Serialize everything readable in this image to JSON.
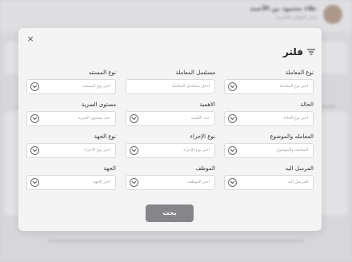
{
  "background": {
    "user_name": "علاء محمود بن الأحمد",
    "user_role": "مدير الموارد البشرية"
  },
  "modal": {
    "title": "فلتر",
    "close_glyph": "×",
    "search_label": "بحث",
    "fields": [
      {
        "label": "نوع المعاملة",
        "placeholder": "اختر نوع المعاملة"
      },
      {
        "label": "مسلسل المعاملة",
        "placeholder": "ادخل مسلسل المعاملة"
      },
      {
        "label": "نوع المستند",
        "placeholder": "اختر نوع المستند"
      },
      {
        "label": "الحالة",
        "placeholder": "اختر نوع الحالة"
      },
      {
        "label": "الاهمية",
        "placeholder": "حدد الأهمية"
      },
      {
        "label": "مستوى السرية",
        "placeholder": "حدد مستوى السرية"
      },
      {
        "label": "المعامله والموضوع",
        "placeholder": "المعاملة والموضوع"
      },
      {
        "label": "نوع الإجراء",
        "placeholder": "اختر نوع الإجراء"
      },
      {
        "label": "نوع الجهة",
        "placeholder": "اختر نوع الاجراء"
      },
      {
        "label": "المرسل اليه",
        "placeholder": "المرسل اليه"
      },
      {
        "label": "الموظف",
        "placeholder": "اختر الموظف"
      },
      {
        "label": "الجهة",
        "placeholder": "اختر الجهة"
      }
    ]
  },
  "colors": {
    "modal_bg": "#f4f4f5",
    "button_bg": "#86868a",
    "text": "#222222",
    "placeholder": "#a2a2a8"
  },
  "icons": {
    "close": "close-icon",
    "filter": "filter-icon",
    "dropdown": "chevron-down-icon"
  }
}
